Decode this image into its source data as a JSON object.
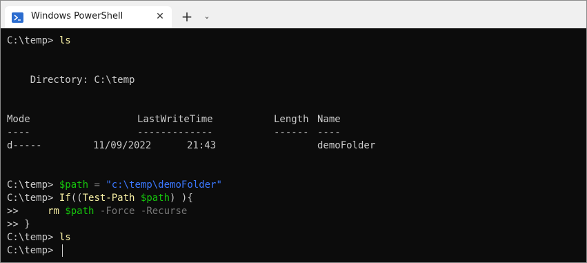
{
  "window": {
    "tab_title": "Windows PowerShell",
    "close_glyph": "✕",
    "new_tab_glyph": "+",
    "dropdown_glyph": "⌄"
  },
  "console": {
    "prompt": "C:\\temp>",
    "cmd1": "ls",
    "directory_line": "    Directory: C:\\temp",
    "headers": {
      "mode": "Mode",
      "lastwrite": "LastWriteTime",
      "length": "Length",
      "name": "Name"
    },
    "underlines": {
      "mode": "----",
      "lastwrite": "-------------",
      "length": "------",
      "name": "----"
    },
    "rows": [
      {
        "mode": "d-----",
        "date": "11/09/2022",
        "time": "21:43",
        "length": "",
        "name": "demoFolder"
      }
    ],
    "cmd2": {
      "var": "$path",
      "op": " = ",
      "str": "\"c:\\temp\\demoFolder\""
    },
    "cmd3": {
      "kw": "If",
      "open": "((",
      "cmdlet": "Test-Path",
      "space": " ",
      "var": "$path",
      "close": ") ){"
    },
    "cont_prompt": ">>",
    "cmd4": {
      "indent": "     ",
      "cmd": "rm",
      "space": " ",
      "var": "$path",
      "args": " -Force -Recurse"
    },
    "cmd5": " }",
    "cmd6": "ls"
  }
}
